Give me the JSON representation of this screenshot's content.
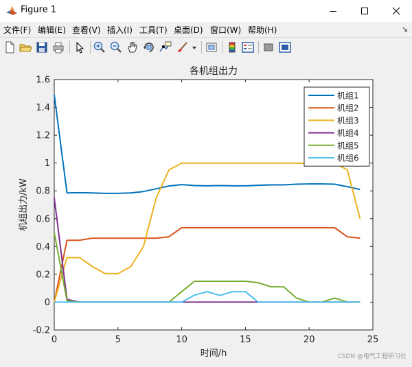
{
  "window": {
    "title": "Figure 1",
    "minimize_glyph": "—",
    "maximize_glyph": "☐",
    "close_glyph": "✕"
  },
  "menu": {
    "items": [
      "文件(F)",
      "编辑(E)",
      "查看(V)",
      "插入(I)",
      "工具(T)",
      "桌面(D)",
      "窗口(W)",
      "帮助(H)"
    ],
    "dock_arrow": "↘"
  },
  "toolbar": {
    "icons": [
      "new-figure-icon",
      "open-folder-icon",
      "save-icon",
      "print-icon",
      "pointer-arrow-icon",
      "zoom-in-icon",
      "zoom-out-icon",
      "pan-hand-icon",
      "rotate-3d-icon",
      "data-cursor-icon",
      "brush-icon",
      "brush-dropdown-icon",
      "link-plot-icon",
      "colorbar-icon",
      "legend-icon",
      "hide-plot-tools-icon",
      "show-plot-tools-icon"
    ]
  },
  "chart_data": {
    "type": "line",
    "title": "各机组出力",
    "xlabel": "时间/h",
    "ylabel": "机组出力/kW",
    "xlim": [
      0,
      25
    ],
    "ylim": [
      -0.2,
      1.6
    ],
    "xticks": [
      0,
      5,
      10,
      15,
      20,
      25
    ],
    "yticks": [
      -0.2,
      0,
      0.2,
      0.4,
      0.6,
      0.8,
      1,
      1.2,
      1.4,
      1.6
    ],
    "ytick_labels": [
      "-0.2",
      "0",
      "0.2",
      "0.4",
      "0.6",
      "0.8",
      "1",
      "1.2",
      "1.4",
      "1.6"
    ],
    "legend_position": "top-right",
    "grid": false,
    "x": [
      0,
      1,
      2,
      3,
      4,
      5,
      6,
      7,
      8,
      9,
      10,
      11,
      12,
      13,
      14,
      15,
      16,
      17,
      18,
      19,
      20,
      21,
      22,
      23,
      24
    ],
    "series": [
      {
        "name": "机组1",
        "color": "#0072BD",
        "values": [
          1.49,
          0.785,
          0.787,
          0.785,
          0.782,
          0.782,
          0.785,
          0.795,
          0.815,
          0.835,
          0.845,
          0.838,
          0.836,
          0.838,
          0.836,
          0.836,
          0.84,
          0.843,
          0.843,
          0.848,
          0.85,
          0.85,
          0.848,
          0.83,
          0.81
        ]
      },
      {
        "name": "机组2",
        "color": "#D95319",
        "values": [
          0,
          0.445,
          0.445,
          0.46,
          0.46,
          0.46,
          0.46,
          0.46,
          0.46,
          0.47,
          0.535,
          0.535,
          0.535,
          0.535,
          0.535,
          0.535,
          0.535,
          0.535,
          0.535,
          0.535,
          0.535,
          0.535,
          0.535,
          0.47,
          0.46
        ]
      },
      {
        "name": "机组3",
        "color": "#EDB120",
        "values": [
          0,
          0.32,
          0.32,
          0.255,
          0.205,
          0.205,
          0.255,
          0.4,
          0.75,
          0.95,
          1.0,
          1.0,
          1.0,
          1.0,
          1.0,
          1.0,
          1.0,
          1.0,
          1.0,
          1.0,
          0.997,
          0.997,
          1.0,
          0.95,
          0.6
        ]
      },
      {
        "name": "机组4",
        "color": "#7E2F8E",
        "values": [
          0.75,
          0.02,
          0,
          0,
          0,
          0,
          0,
          0,
          0,
          0,
          0,
          0,
          0,
          0,
          0,
          0,
          0,
          0,
          0,
          0,
          0,
          0,
          0,
          0,
          0
        ]
      },
      {
        "name": "机组5",
        "color": "#77AC30",
        "values": [
          0.5,
          0.01,
          0,
          0,
          0,
          0,
          0,
          0,
          0,
          0,
          0.075,
          0.15,
          0.15,
          0.15,
          0.15,
          0.15,
          0.14,
          0.11,
          0.11,
          0.03,
          0,
          0,
          0.03,
          0,
          0
        ]
      },
      {
        "name": "机组6",
        "color": "#4DBEEE",
        "values": [
          0,
          0,
          0,
          0,
          0,
          0,
          0,
          0,
          0,
          0,
          0,
          0.05,
          0.075,
          0.048,
          0.075,
          0.075,
          0,
          0,
          0,
          0,
          0,
          0,
          0,
          0,
          0
        ]
      }
    ]
  },
  "watermark": "CSDN @电气工程研习社"
}
